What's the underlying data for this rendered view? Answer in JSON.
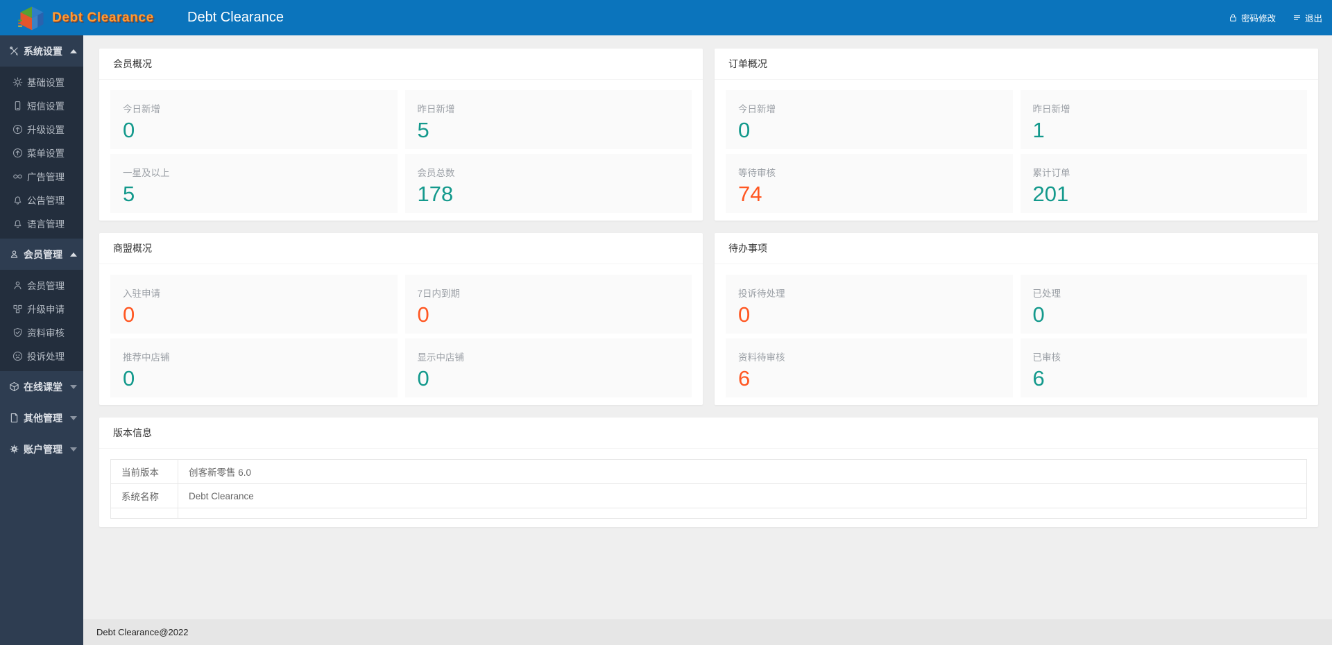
{
  "topbar": {
    "logo_text": "Debt Clearance",
    "title": "Debt Clearance",
    "actions": [
      {
        "name": "change-password",
        "icon": "lock",
        "label": "密码修改"
      },
      {
        "name": "logout",
        "icon": "logout",
        "label": "退出"
      }
    ]
  },
  "sidebar": {
    "groups": [
      {
        "name": "system-settings",
        "icon": "tools",
        "label": "系统设置",
        "expanded": true,
        "items": [
          {
            "name": "basic-settings",
            "icon": "gear",
            "label": "基础设置"
          },
          {
            "name": "sms-settings",
            "icon": "phone",
            "label": "短信设置"
          },
          {
            "name": "upgrade-settings",
            "icon": "arrow-up-circle",
            "label": "升级设置"
          },
          {
            "name": "menu-settings",
            "icon": "arrow-up-circle",
            "label": "菜单设置"
          },
          {
            "name": "ad-management",
            "icon": "infinity",
            "label": "广告管理"
          },
          {
            "name": "announcement-management",
            "icon": "bell",
            "label": "公告管理"
          },
          {
            "name": "language-management",
            "icon": "bell",
            "label": "语言管理"
          }
        ]
      },
      {
        "name": "member-management-group",
        "icon": "user-frame",
        "label": "会员管理",
        "expanded": true,
        "items": [
          {
            "name": "member-management",
            "icon": "user",
            "label": "会员管理"
          },
          {
            "name": "upgrade-application",
            "icon": "grid",
            "label": "升级申请"
          },
          {
            "name": "profile-review",
            "icon": "shield-check",
            "label": "资料审核"
          },
          {
            "name": "complaint-handling",
            "icon": "frown",
            "label": "投诉处理"
          }
        ]
      },
      {
        "name": "online-classroom",
        "icon": "cube",
        "label": "在线课堂",
        "expanded": false,
        "items": []
      },
      {
        "name": "other-management",
        "icon": "file",
        "label": "其他管理",
        "expanded": false,
        "items": []
      },
      {
        "name": "account-management",
        "icon": "gear-solid",
        "label": "账户管理",
        "expanded": false,
        "items": []
      }
    ]
  },
  "overview_cards": [
    {
      "name": "member-overview",
      "title": "会员概况",
      "tiles": [
        {
          "name": "today-added",
          "label": "今日新增",
          "value": "0",
          "color": "teal"
        },
        {
          "name": "yesterday-added",
          "label": "昨日新增",
          "value": "5",
          "color": "teal"
        },
        {
          "name": "one-star-and-above",
          "label": "一星及以上",
          "value": "5",
          "color": "teal"
        },
        {
          "name": "total-members",
          "label": "会员总数",
          "value": "178",
          "color": "teal"
        }
      ]
    },
    {
      "name": "order-overview",
      "title": "订单概况",
      "tiles": [
        {
          "name": "today-added",
          "label": "今日新增",
          "value": "0",
          "color": "teal"
        },
        {
          "name": "yesterday-added",
          "label": "昨日新增",
          "value": "1",
          "color": "teal"
        },
        {
          "name": "pending-review",
          "label": "等待审核",
          "value": "74",
          "color": "orange"
        },
        {
          "name": "total-orders",
          "label": "累计订单",
          "value": "201",
          "color": "teal"
        }
      ]
    },
    {
      "name": "alliance-overview",
      "title": "商盟概况",
      "tiles": [
        {
          "name": "settle-in-applications",
          "label": "入驻申请",
          "value": "0",
          "color": "orange"
        },
        {
          "name": "expiring-in-7-days",
          "label": "7日内到期",
          "value": "0",
          "color": "orange"
        },
        {
          "name": "recommended-shops",
          "label": "推荐中店铺",
          "value": "0",
          "color": "teal"
        },
        {
          "name": "visible-shops",
          "label": "显示中店铺",
          "value": "0",
          "color": "teal"
        }
      ]
    },
    {
      "name": "todo-items",
      "title": "待办事项",
      "tiles": [
        {
          "name": "complaints-pending",
          "label": "投诉待处理",
          "value": "0",
          "color": "orange"
        },
        {
          "name": "complaints-handled",
          "label": "已处理",
          "value": "0",
          "color": "teal"
        },
        {
          "name": "profiles-pending-review",
          "label": "资料待审核",
          "value": "6",
          "color": "orange"
        },
        {
          "name": "profiles-reviewed",
          "label": "已审核",
          "value": "6",
          "color": "teal"
        }
      ]
    },
    {
      "name": "version-info",
      "title": "版本信息",
      "tiles": []
    }
  ],
  "version_card": {
    "title": "版本信息",
    "rows": [
      {
        "label": "当前版本",
        "value": "创客新零售 6.0"
      },
      {
        "label": "系统名称",
        "value": "Debt Clearance"
      },
      {
        "label": "",
        "value": ""
      }
    ]
  },
  "colors": {
    "topbar_blue": "#0b74bc",
    "sidebar_base": "#2e3d51",
    "sidebar_submenu": "#232e3d",
    "accent_teal": "#13998c",
    "accent_orange": "#ff5722",
    "logo_orange": "#ff9b35"
  },
  "footer": {
    "copyright": "Debt Clearance@2022"
  }
}
